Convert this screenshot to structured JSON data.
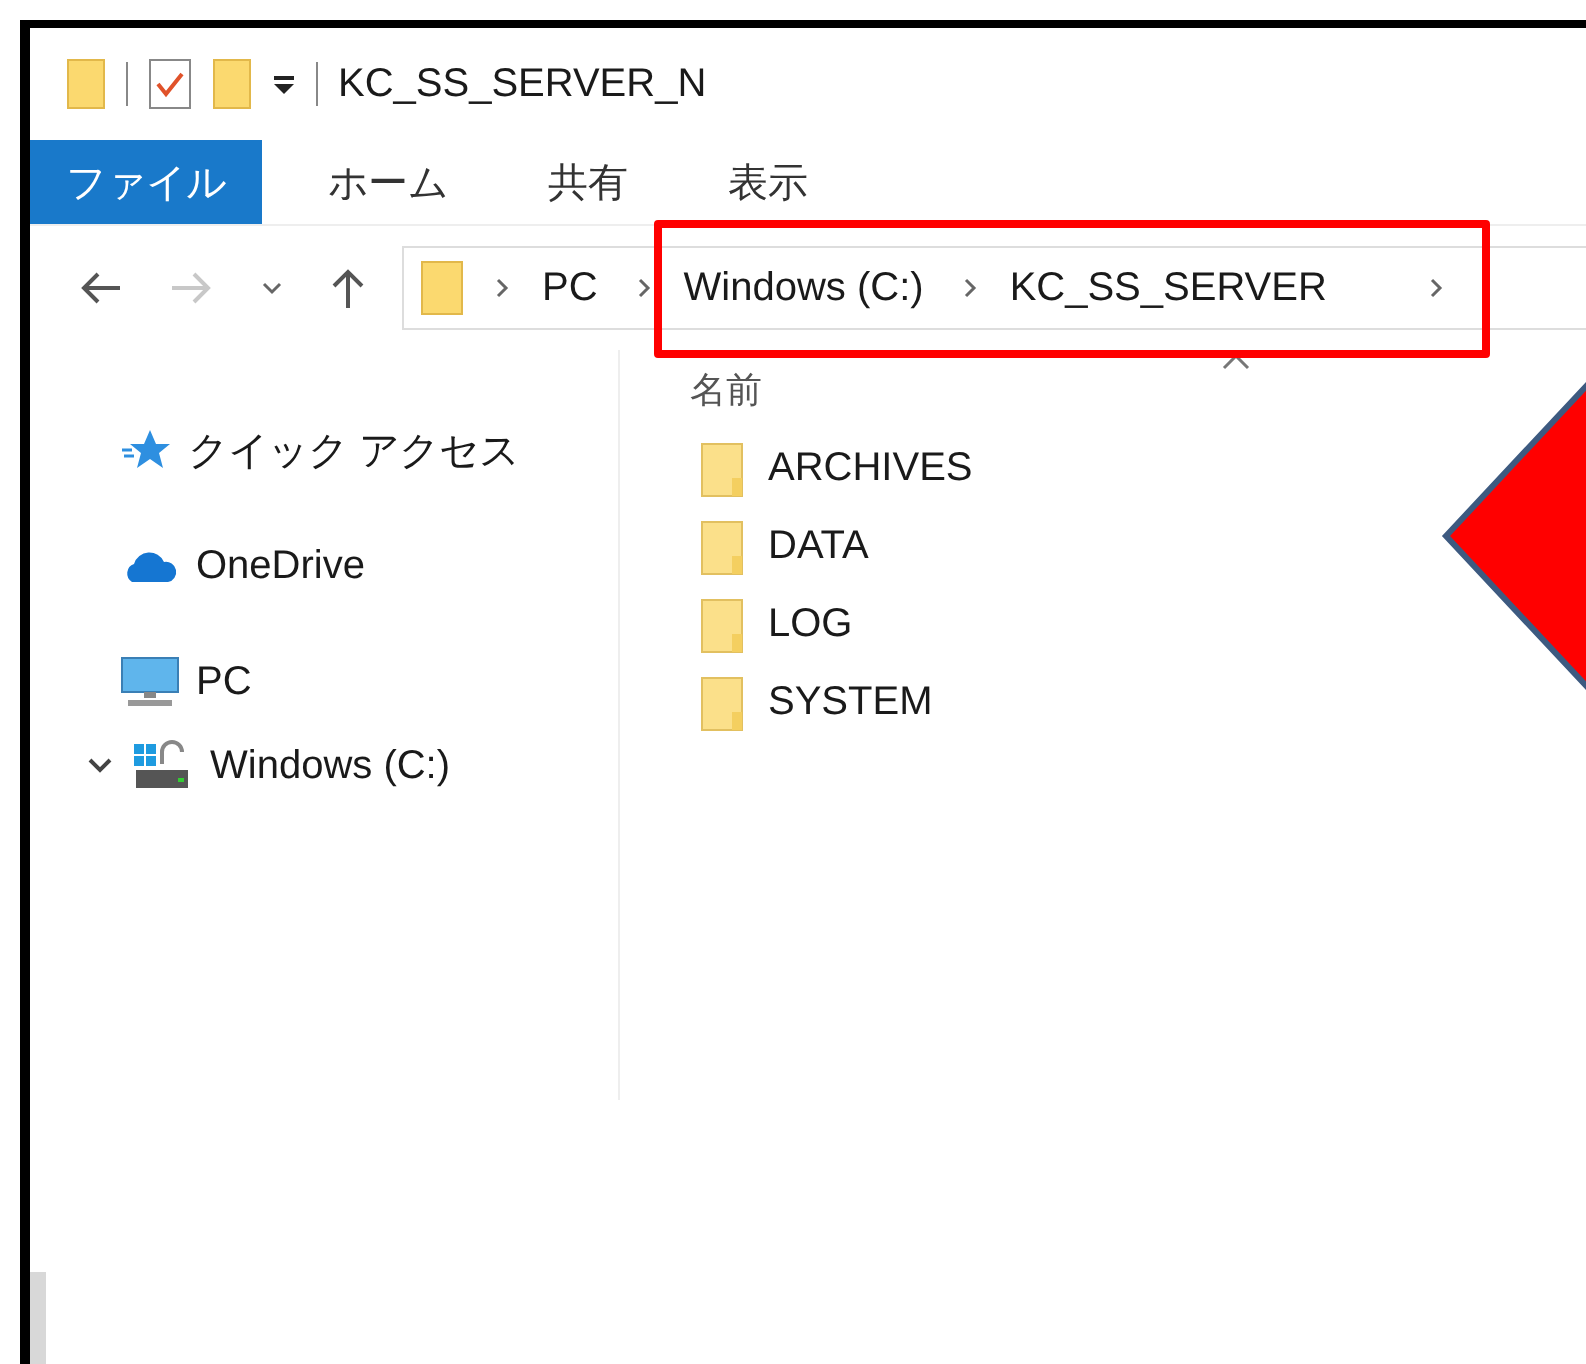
{
  "window": {
    "title": "KC_SS_SERVER_N"
  },
  "ribbon_tabs": [
    {
      "label": "ファイル",
      "selected": true
    },
    {
      "label": "ホーム",
      "selected": false
    },
    {
      "label": "共有",
      "selected": false
    },
    {
      "label": "表示",
      "selected": false
    }
  ],
  "address_bar": {
    "breadcrumbs": [
      "PC",
      "Windows (C:)",
      "KC_SS_SERVER"
    ]
  },
  "nav_items": [
    {
      "label": "クイック アクセス",
      "kind": "quick"
    },
    {
      "label": "OneDrive",
      "kind": "cloud"
    },
    {
      "label": "PC",
      "kind": "pc"
    },
    {
      "label": "Windows (C:)",
      "kind": "drive",
      "expanded": true
    }
  ],
  "file_list": {
    "column": "名前",
    "items": [
      "ARCHIVES",
      "DATA",
      "LOG",
      "SYSTEM"
    ]
  },
  "annotations": {
    "highlight_box": true,
    "pointer": true
  }
}
